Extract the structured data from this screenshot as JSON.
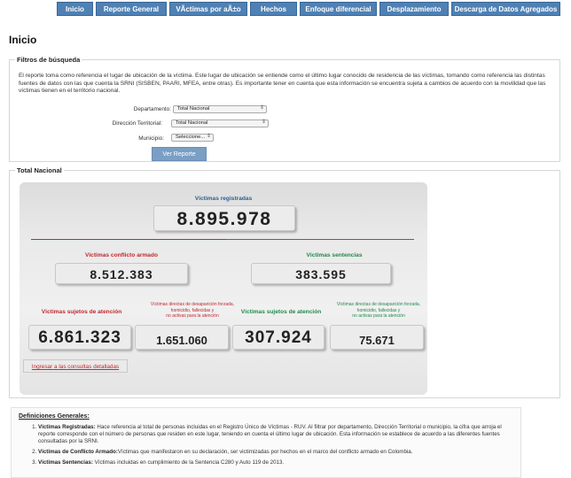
{
  "nav": {
    "tabs": [
      "Inicio",
      "Reporte General",
      "VÃctimas por aÃ±o",
      "Hechos",
      "Enfoque diferencial",
      "Desplazamiento",
      "Descarga de Datos Agregados"
    ]
  },
  "page": {
    "title": "Inicio"
  },
  "filters": {
    "legend": "Filtros de búsqueda",
    "description": "El reporte toma como referencia el lugar de ubicación de la víctima. Este lugar de ubicación se entiende como el último lugar conocido de residencia de las víctimas, tomando como referencia las distintas fuentes de datos con las que cuenta la SRNI (SISBEN, PAARI, MFEA, entre otras). Es importante tener en cuenta que esta información se encuentra sujeta a cambios de acuerdo con la movilidad que las víctimas tienen en el territorio nacional.",
    "departamento_label": "Departamento:",
    "departamento_value": "Total Nacional",
    "direccion_label": "Dirección Territorial:",
    "direccion_value": "Total Nacional",
    "municipio_label": "Municipio:",
    "municipio_value": "Seleccione...",
    "submit_label": "Ver Reporte"
  },
  "totals": {
    "legend": "Total Nacional",
    "registradas_label": "Víctimas registradas",
    "registradas_value": "8.895.978",
    "conflicto_label": "Víctimas conflicto armado",
    "conflicto_value": "8.512.383",
    "sentencias_label": "Víctimas sentencias",
    "sentencias_value": "383.595",
    "atencion_conf_label": "Víctimas sujetos de atención",
    "atencion_conf_value": "6.861.323",
    "directas_conf_label_1": "Víctimas directas de desaparición forzada,",
    "directas_conf_label_2": "homicidio, fallecidas y",
    "directas_conf_label_3": "no activas para la atención",
    "directas_conf_value": "1.651.060",
    "atencion_sent_label": "Víctimas sujetos de atención",
    "atencion_sent_value": "307.924",
    "directas_sent_label_1": "Víctimas directas de desaparición forzada,",
    "directas_sent_label_2": "homicidio, fallecidas y",
    "directas_sent_label_3": "no activas para la atención",
    "directas_sent_value": "75.671",
    "link_label": "Ingresar a las consultas detalladas"
  },
  "definitions": {
    "title": "Definiciones Generales:",
    "items": [
      {
        "term": "Víctimas Registradas:",
        "text": " Hace referencia al total de personas incluidas en el Registro Único de Víctimas - RUV. Al filtrar por departamento, Dirección Territorial o municipio, la cifra que arroja el reporte corresponde con el número de personas que residen en este lugar, teniendo en cuenta el último lugar de ubicación. Esta información se establece de acuerdo a las diferentes fuentes consultadas por la SRNI."
      },
      {
        "term": "Víctimas de Conflicto Armado:",
        "text": "Víctimas que manifestaron en su declaración, ser victimizadas por hechos en el marco del conflicto armado en Colombia."
      },
      {
        "term": "Víctimas Sentencias:",
        "text": " Víctimas incluidas en cumplimiento de la Sentencia C280 y Auto 119 de 2013."
      }
    ]
  },
  "colors": {
    "nav": "#4f81b4",
    "red": "#c0282f",
    "green": "#1f8a4a",
    "blue": "#2b5f94"
  }
}
